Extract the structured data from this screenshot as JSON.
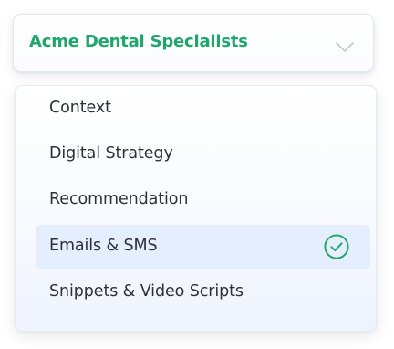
{
  "dropdown": {
    "selected_label": "Acme Dental Specialists",
    "toggle_icon": "chevron-down-icon"
  },
  "menu": {
    "items": [
      {
        "label": "Context",
        "selected": false
      },
      {
        "label": "Digital Strategy",
        "selected": false
      },
      {
        "label": "Recommendation",
        "selected": false
      },
      {
        "label": "Emails & SMS",
        "selected": true,
        "icon": "check-circle-icon"
      },
      {
        "label": "Snippets & Video Scripts",
        "selected": false
      }
    ]
  },
  "colors": {
    "accent": "#1fa56d",
    "selected_row": "#e5eefd",
    "text": "#2d3137",
    "chevron": "#c3c8cf"
  }
}
